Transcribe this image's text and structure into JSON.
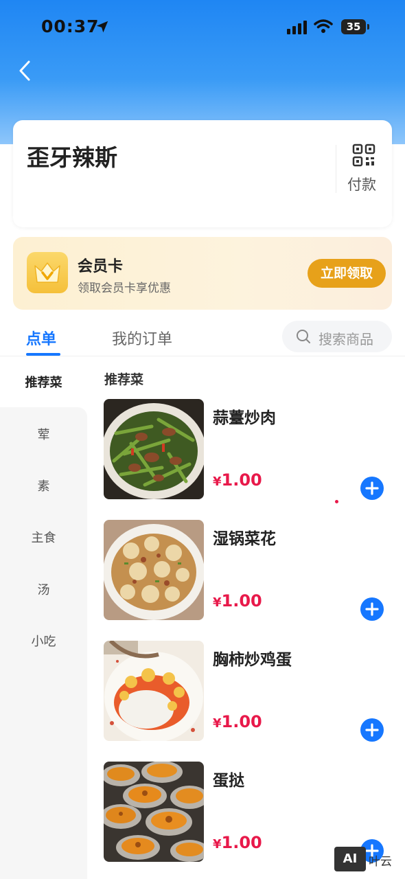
{
  "status_bar": {
    "time": "00:37",
    "battery": "35"
  },
  "store": {
    "name": "歪牙辣斯",
    "pay_label": "付款"
  },
  "member": {
    "title": "会员卡",
    "subtitle": "领取会员卡享优惠",
    "button": "立即领取"
  },
  "tabs": {
    "order": "点单",
    "my_orders": "我的订单"
  },
  "search": {
    "placeholder": "搜索商品"
  },
  "sidebar": {
    "items": [
      "推荐菜",
      "荤",
      "素",
      "主食",
      "汤",
      "小吃"
    ],
    "active_index": 0
  },
  "section_title": "推荐菜",
  "dishes": [
    {
      "name": "蒜薹炒肉",
      "currency": "¥",
      "price": "1.00"
    },
    {
      "name": "湿锅菜花",
      "currency": "¥",
      "price": "1.00"
    },
    {
      "name": "胸柿炒鸡蛋",
      "currency": "¥",
      "price": "1.00"
    },
    {
      "name": "蛋挞",
      "currency": "¥",
      "price": "1.00"
    }
  ],
  "watermark": {
    "logo": "AI",
    "text": "叶云"
  },
  "colors": {
    "accent": "#1677ff",
    "price": "#e8194a",
    "member_button": "#e7a11a",
    "header_blue": "#1f86f3"
  },
  "icons": [
    "location-arrow-icon",
    "signal-icon",
    "wifi-icon",
    "back-chevron-icon",
    "qr-code-icon",
    "crown-icon",
    "search-icon",
    "plus-icon"
  ]
}
